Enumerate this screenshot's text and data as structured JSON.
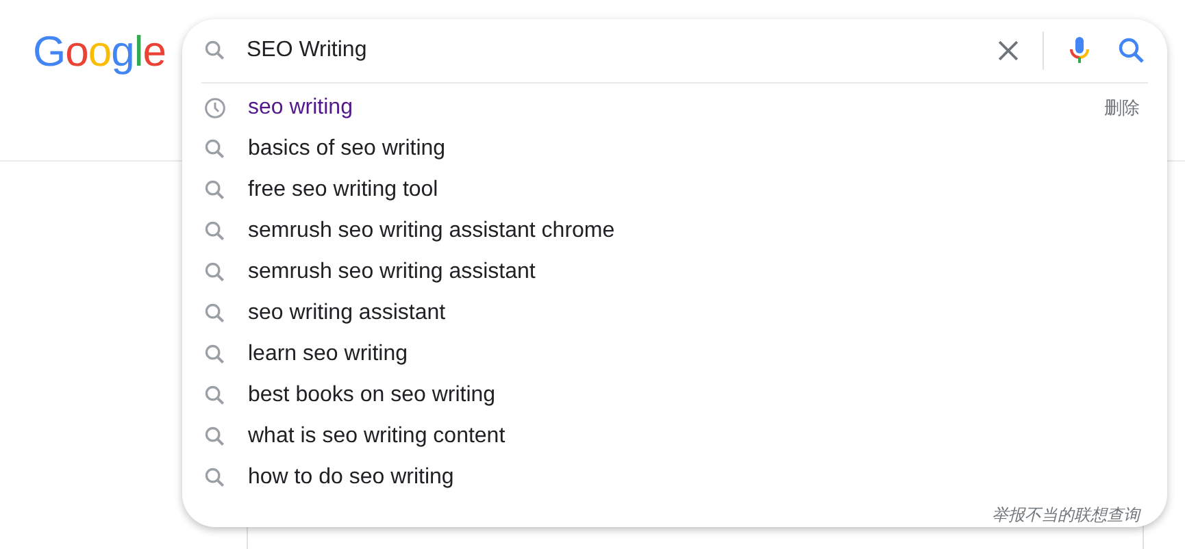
{
  "logo": {
    "letters": [
      {
        "char": "G",
        "color": "#4285f4"
      },
      {
        "char": "o",
        "color": "#ea4335"
      },
      {
        "char": "o",
        "color": "#fbbc05"
      },
      {
        "char": "g",
        "color": "#4285f4"
      },
      {
        "char": "l",
        "color": "#34a853"
      },
      {
        "char": "e",
        "color": "#ea4335"
      }
    ]
  },
  "search": {
    "value": "SEO Writing"
  },
  "suggestions": [
    {
      "kind": "history",
      "text": "seo writing",
      "remove": "删除"
    },
    {
      "kind": "query",
      "text": "basics of seo writing"
    },
    {
      "kind": "query",
      "text": "free seo writing tool"
    },
    {
      "kind": "query",
      "text": "semrush seo writing assistant chrome"
    },
    {
      "kind": "query",
      "text": "semrush seo writing assistant"
    },
    {
      "kind": "query",
      "text": "seo writing assistant"
    },
    {
      "kind": "query",
      "text": "learn seo writing"
    },
    {
      "kind": "query",
      "text": "best books on seo writing"
    },
    {
      "kind": "query",
      "text": "what is seo writing content"
    },
    {
      "kind": "query",
      "text": "how to do seo writing"
    }
  ],
  "report_link": "举报不当的联想查询"
}
